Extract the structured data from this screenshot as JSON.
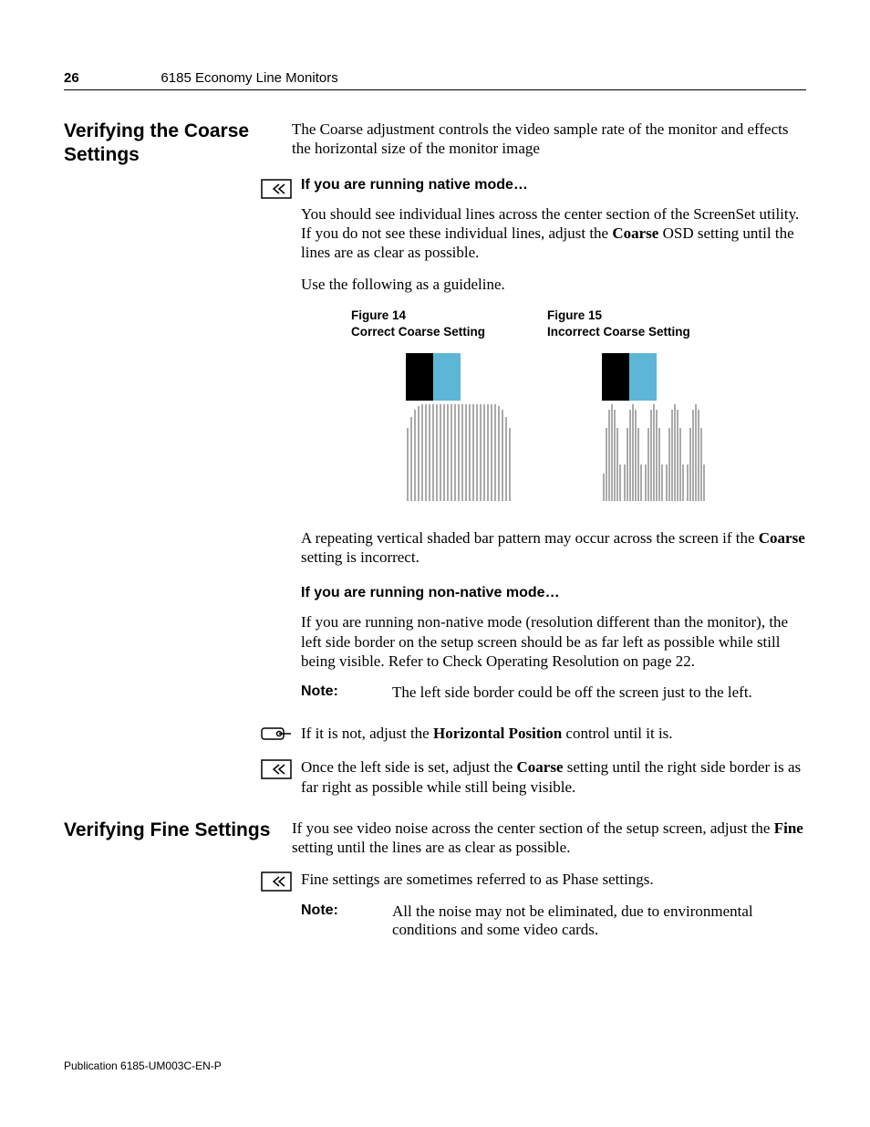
{
  "header": {
    "page_number": "26",
    "title": "6185 Economy Line Monitors"
  },
  "s1": {
    "heading": "Verifying the Coarse Settings",
    "intro": "The Coarse adjustment controls the video sample rate of the monitor and effects the horizontal size of the monitor image",
    "native_h": "If you are running native mode…",
    "native_p1a": "You should see individual lines across the center section of the ScreenSet utility. If you do not see these individual lines, adjust the ",
    "native_p1_bold": "Coarse",
    "native_p1b": " OSD setting until the lines are as clear as possible.",
    "native_p2": "Use the following as a guideline.",
    "fig14_n": "Figure 14",
    "fig14_t": "Correct Coarse Setting",
    "fig15_n": "Figure 15",
    "fig15_t": "Incorrect Coarse Setting",
    "after_fig_a": "A repeating vertical shaded bar pattern may occur across the screen if the ",
    "after_fig_bold": "Coarse",
    "after_fig_b": " setting is incorrect.",
    "nonnative_h": "If you are running non-native mode…",
    "nonnative_p": "If you are running non-native mode (resolution different than the monitor), the left side border on the setup screen should be as far left as possible while still being visible. Refer to Check Operating Resolution on page 22.",
    "note1_lbl": "Note:",
    "note1_txt": "The left side border could be off the screen just to the left.",
    "hp_a": "If it is not, adjust the ",
    "hp_bold": "Horizontal Position",
    "hp_b": " control until it is.",
    "coarse2_a": "Once the left side is set, adjust the ",
    "coarse2_bold": "Coarse",
    "coarse2_b": " setting until the right side border is as far right as possible while still being visible."
  },
  "s2": {
    "heading": "Verifying Fine Settings",
    "p1_a": "If you see video noise across the center section of the setup screen, adjust the ",
    "p1_bold": "Fine",
    "p1_b": " setting until the lines are as clear as possible.",
    "p2": "Fine settings are sometimes referred to as Phase settings.",
    "note2_lbl": "Note:",
    "note2_txt": "All the noise may not be eliminated, due to environmental conditions and some video cards."
  },
  "footer": "Publication 6185-UM003C-EN-P"
}
